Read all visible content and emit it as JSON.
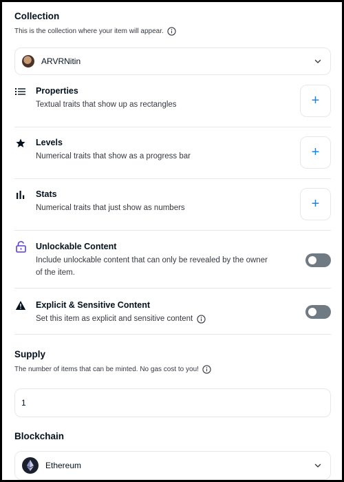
{
  "collection": {
    "title": "Collection",
    "description": "This is the collection where your item will appear.",
    "selected": "ARVRNitin"
  },
  "properties": {
    "title": "Properties",
    "description": "Textual traits that show up as rectangles",
    "add_label": "+"
  },
  "levels": {
    "title": "Levels",
    "description": "Numerical traits that show as a progress bar",
    "add_label": "+"
  },
  "stats": {
    "title": "Stats",
    "description": "Numerical traits that just show as numbers",
    "add_label": "+"
  },
  "unlockable": {
    "title": "Unlockable Content",
    "description_line1": "Include unlockable content that can only be revealed by the owner",
    "description_line2": "of the item.",
    "enabled": false
  },
  "explicit": {
    "title": "Explicit & Sensitive Content",
    "description": "Set this item as explicit and sensitive content",
    "enabled": false
  },
  "supply": {
    "title": "Supply",
    "description": "The number of items that can be minted. No gas cost to you!",
    "value": "1"
  },
  "blockchain": {
    "title": "Blockchain",
    "selected": "Ethereum"
  },
  "icons": {
    "properties": "list-icon",
    "levels": "star-icon",
    "stats": "bar-chart-icon",
    "unlockable": "lock-icon",
    "explicit": "warning-icon",
    "info": "info-icon",
    "chevron": "chevron-down-icon",
    "ethereum": "ethereum-icon"
  },
  "colors": {
    "accent": "#2081e2",
    "lock": "#5b3fd4",
    "toggle_off": "#707a83",
    "border": "#e5e8eb",
    "text": "#04111d"
  }
}
